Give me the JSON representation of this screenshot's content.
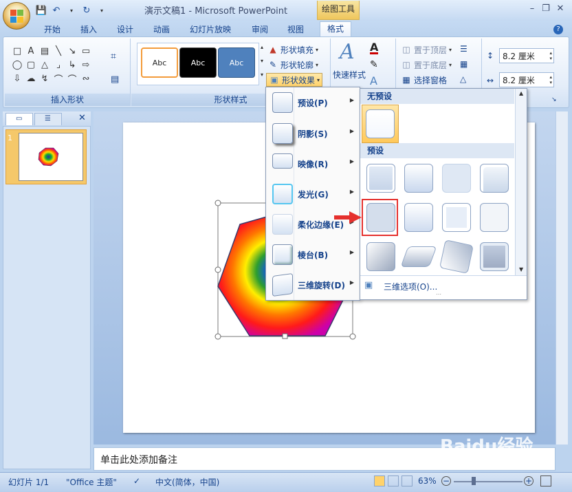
{
  "window": {
    "title": "演示文稿1 - Microsoft PowerPoint",
    "contextual_tab": "绘图工具"
  },
  "tabs": [
    "开始",
    "插入",
    "设计",
    "动画",
    "幻灯片放映",
    "审阅",
    "视图",
    "格式"
  ],
  "ribbon": {
    "insert_shapes_label": "插入形状",
    "shape_styles_label": "形状样式",
    "style_sample_text": "Abc",
    "fill_label": "形状填充",
    "outline_label": "形状轮廓",
    "effects_label": "形状效果",
    "quick_styles_label": "快速样式",
    "bring_front_label": "置于顶层",
    "send_back_label": "置于底层",
    "selection_pane_label": "选择窗格",
    "height_value": "8.2 厘米",
    "width_value": "8.2 厘米"
  },
  "effects_menu": [
    {
      "label": "预设(P)"
    },
    {
      "label": "阴影(S)"
    },
    {
      "label": "映像(R)"
    },
    {
      "label": "发光(G)"
    },
    {
      "label": "柔化边缘(E)"
    },
    {
      "label": "棱台(B)"
    },
    {
      "label": "三维旋转(D)"
    }
  ],
  "preset_submenu": {
    "no_preset_header": "无预设",
    "preset_header": "预设",
    "options_label": "三维选项(O)..."
  },
  "notes_placeholder": "单击此处添加备注",
  "status": {
    "slide": "幻灯片 1/1",
    "theme": "\"Office 主题\"",
    "language": "中文(简体，中国)",
    "zoom": "63%"
  },
  "slide_panel": {
    "thumb_number": "1"
  },
  "watermark": "Baidu经验",
  "colors": {
    "accent_ribbon": "#bcd3ee",
    "highlight": "#ffd26b",
    "callout_red": "#e5302d"
  }
}
